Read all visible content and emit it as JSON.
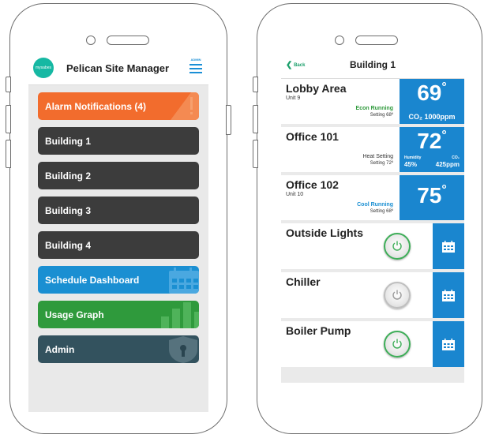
{
  "left_app": {
    "logo_text": "mysabes",
    "title": "Pelican Site Manager",
    "menu_badge": "ADMIN",
    "buttons": [
      {
        "label": "Alarm Notifications (4)",
        "color": "#f26c2d"
      },
      {
        "label": "Building 1",
        "color": "#3c3c3c"
      },
      {
        "label": "Building 2",
        "color": "#3c3c3c"
      },
      {
        "label": "Building 3",
        "color": "#3c3c3c"
      },
      {
        "label": "Building 4",
        "color": "#3c3c3c"
      },
      {
        "label": "Schedule Dashboard",
        "color": "#1a8fd2"
      },
      {
        "label": "Usage Graph",
        "color": "#2f9a3c"
      },
      {
        "label": "Admin",
        "color": "#33525e"
      }
    ]
  },
  "right_app": {
    "back_label": "Back",
    "title": "Building 1",
    "zones": [
      {
        "name": "Lobby Area",
        "unit": "Unit 9",
        "status": "Econ Running",
        "status_color": "#2f9a3c",
        "setting": "Setting 68º",
        "temp": "69",
        "co2_label": "CO₂ 1000ppm"
      },
      {
        "name": "Office 101",
        "unit": "",
        "status": "Heat Setting",
        "status_color": "#333333",
        "setting": "Setting 72º",
        "temp": "72",
        "humidity_label": "Humidity",
        "humidity": "45%",
        "co2_small_label": "CO₂",
        "co2": "425ppm"
      },
      {
        "name": "Office 102",
        "unit": "Unit 10",
        "status": "Cool Running",
        "status_color": "#1a8fd2",
        "setting": "Setting 68º",
        "temp": "75"
      }
    ],
    "devices": [
      {
        "name": "Outside Lights",
        "state": "on"
      },
      {
        "name": "Chiller",
        "state": "off"
      },
      {
        "name": "Boiler Pump",
        "state": "on"
      }
    ]
  }
}
